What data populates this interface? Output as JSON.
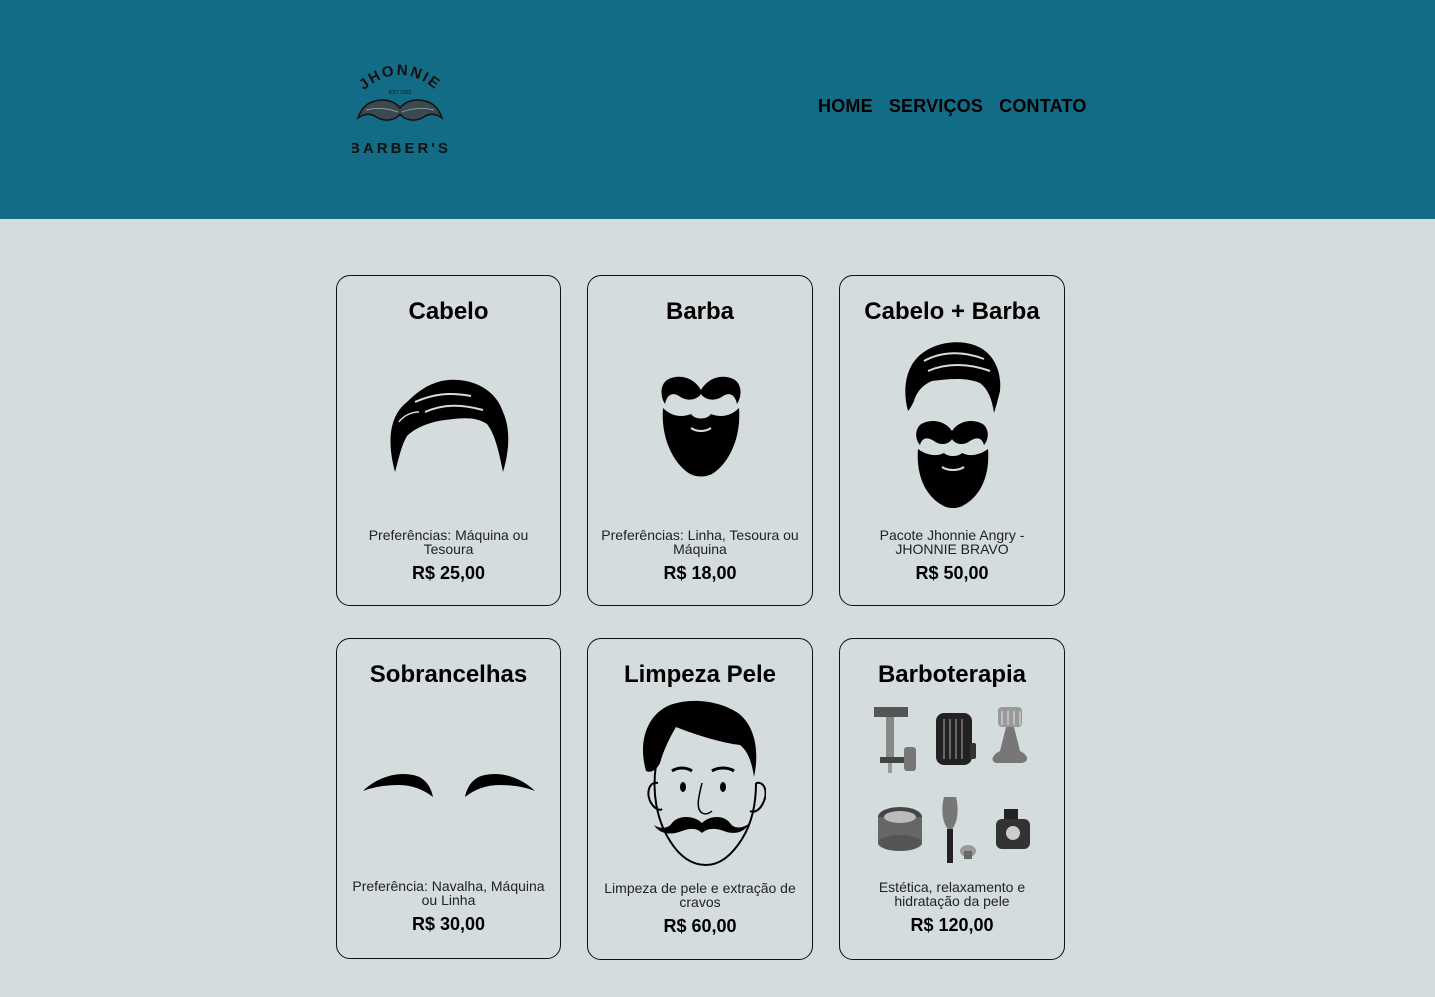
{
  "brand": {
    "logo_top": "JHONNIE",
    "logo_est": "EST 2022",
    "logo_bottom": "BARBER'S",
    "primary_color": "#136c85",
    "background_color": "#d5dcde"
  },
  "nav": {
    "items": [
      {
        "label": "HOME"
      },
      {
        "label": "SERVIÇOS"
      },
      {
        "label": "CONTATO"
      }
    ]
  },
  "services": [
    {
      "title": "Cabelo",
      "description": "Preferências: Máquina ou Tesoura",
      "price": "R$ 25,00",
      "icon": "hair-icon"
    },
    {
      "title": "Barba",
      "description": "Preferências: Linha, Tesoura ou Máquina",
      "price": "R$ 18,00",
      "icon": "beard-icon"
    },
    {
      "title": "Cabelo + Barba",
      "description": "Pacote Jhonnie Angry - JHONNIE BRAVO",
      "price": "R$ 50,00",
      "icon": "hair-and-beard-icon"
    },
    {
      "title": "Sobrancelhas",
      "description": "Preferência: Navalha, Máquina ou Linha",
      "price": "R$ 30,00",
      "icon": "eyebrows-icon"
    },
    {
      "title": "Limpeza Pele",
      "description": "Limpeza de pele e extração de cravos",
      "price": "R$ 60,00",
      "icon": "face-icon"
    },
    {
      "title": "Barboterapia",
      "description": "Estética, relaxamento e hidratação da pele",
      "price": "R$ 120,00",
      "icon": "grooming-kit-icon"
    }
  ]
}
